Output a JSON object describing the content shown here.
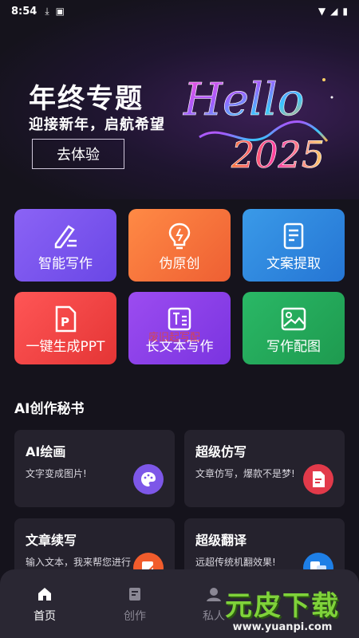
{
  "status_bar": {
    "time": "8:54"
  },
  "banner": {
    "title": "年终专题",
    "subtitle": "迎接新年，启航希望",
    "button": "去体验",
    "art_text_1": "Hello",
    "art_text_2": "2025"
  },
  "tools": [
    {
      "label": "智能写作",
      "icon": "pen-icon",
      "color": "#7a57f0"
    },
    {
      "label": "伪原创",
      "icon": "bulb-icon",
      "color": "#f06a3a"
    },
    {
      "label": "文案提取",
      "icon": "document-icon",
      "color": "#2e86dd"
    },
    {
      "label": "一键生成PPT",
      "icon": "ppt-icon",
      "color": "#ee3d3d"
    },
    {
      "label": "长文本写作",
      "icon": "text-icon",
      "color": "#8a3fe8"
    },
    {
      "label": "写作配图",
      "icon": "image-icon",
      "color": "#22a457"
    }
  ],
  "overlay_text": "废旧起写配",
  "section_title": "AI创作秘书",
  "cards": [
    {
      "title": "AI绘画",
      "desc": "文字变成图片!",
      "icon": "palette-icon",
      "color": "#7d57e8"
    },
    {
      "title": "超级仿写",
      "desc": "文章仿写，爆款不是梦!",
      "icon": "document-icon",
      "color": "#e23a4a"
    },
    {
      "title": "文章续写",
      "desc": "输入文本，我来帮您进行智能续写",
      "icon": "edit-icon",
      "color": "#f15c2c"
    },
    {
      "title": "超级翻译",
      "desc": "远超传统机翻效果!",
      "icon": "translate-icon",
      "color": "#1e7fe6"
    }
  ],
  "tabbar": {
    "tabs": [
      {
        "label": "首页",
        "icon": "home-icon"
      },
      {
        "label": "创作",
        "icon": "compose-icon"
      },
      {
        "label": "私人",
        "icon": "user-icon"
      }
    ]
  },
  "watermark": {
    "main": "元皮下载",
    "url": "www.yuanpi.com"
  }
}
